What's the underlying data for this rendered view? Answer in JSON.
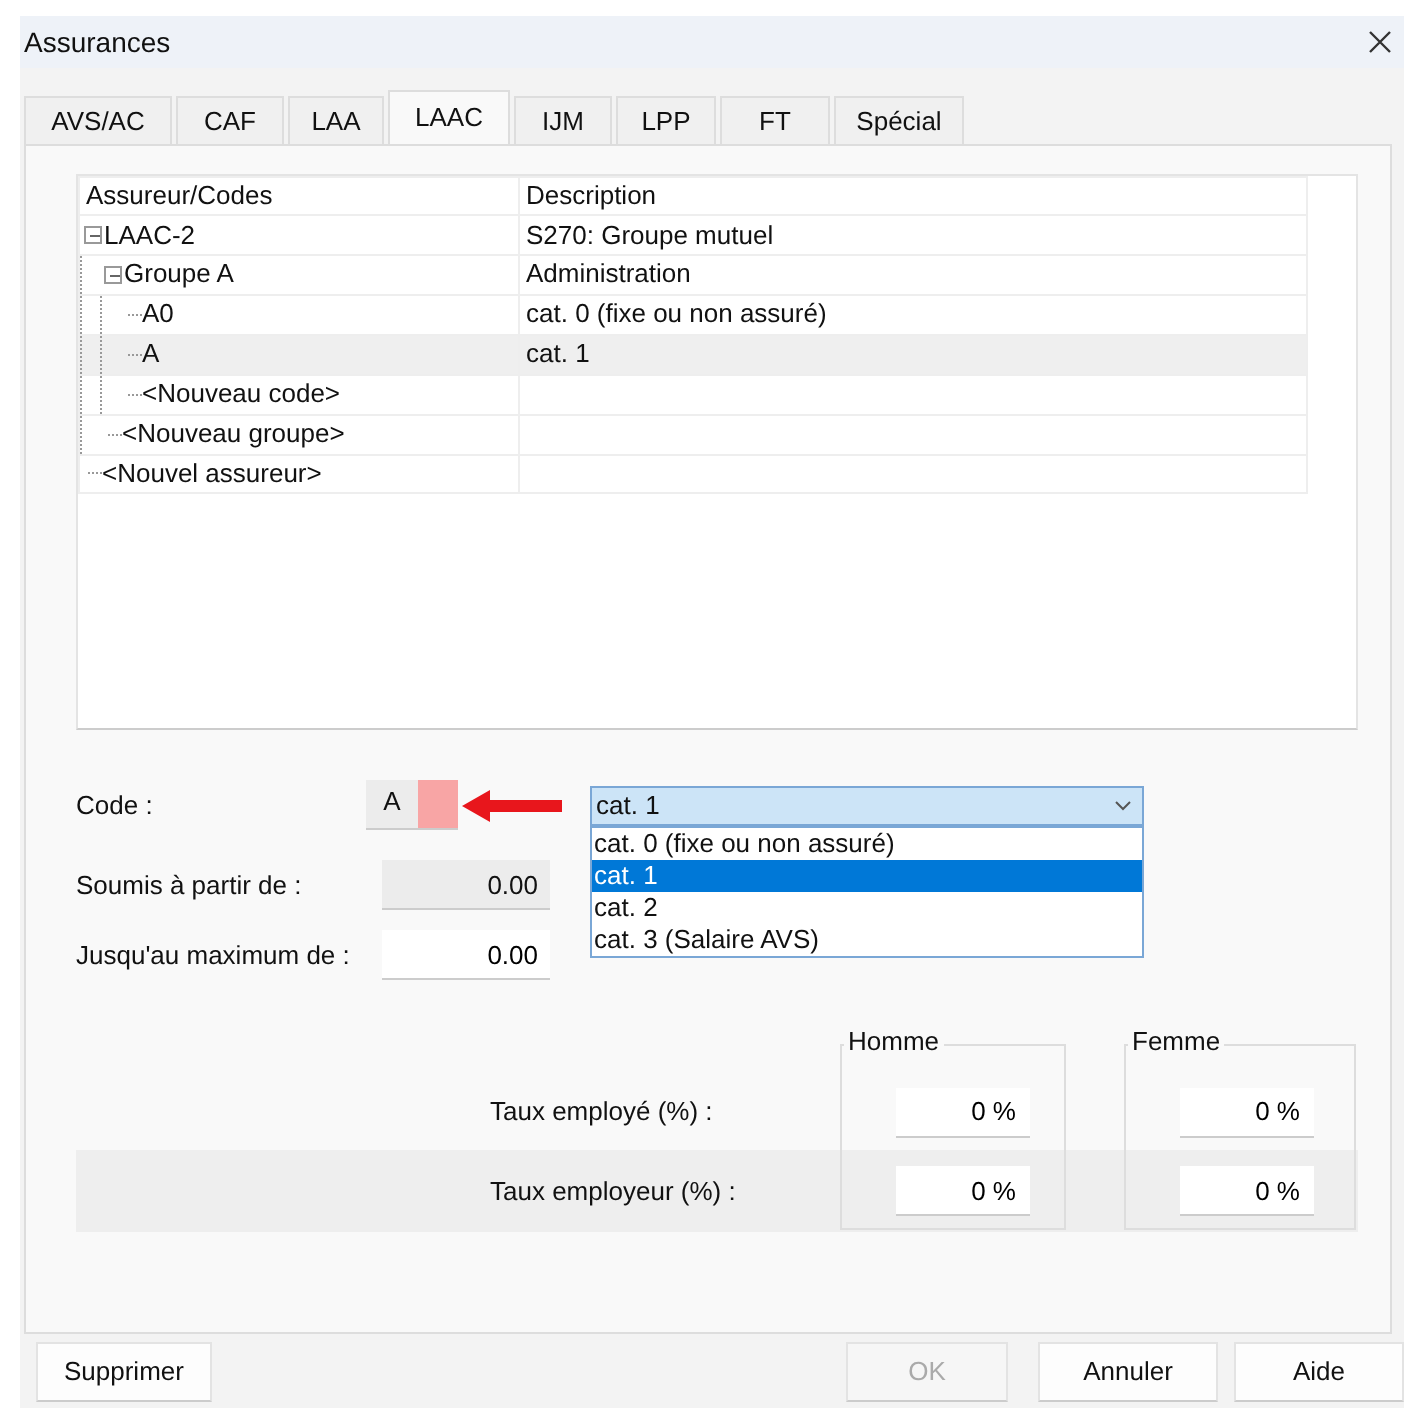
{
  "window": {
    "title": "Assurances"
  },
  "tabs": [
    {
      "label": "AVS/AC",
      "selected": false
    },
    {
      "label": "CAF",
      "selected": false
    },
    {
      "label": "LAA",
      "selected": false
    },
    {
      "label": "LAAC",
      "selected": true
    },
    {
      "label": "IJM",
      "selected": false
    },
    {
      "label": "LPP",
      "selected": false
    },
    {
      "label": "FT",
      "selected": false
    },
    {
      "label": "Spécial",
      "selected": false
    }
  ],
  "tree": {
    "columns": [
      "Assureur/Codes",
      "Description"
    ],
    "rows": [
      {
        "code": "LAAC-2",
        "description": "S270: Groupe mutuel",
        "expanded": true,
        "selected": false,
        "children": [
          {
            "code": "Groupe A",
            "description": "Administration",
            "expanded": true,
            "selected": false,
            "children": [
              {
                "code": "A0",
                "description": "cat. 0 (fixe ou non assuré)",
                "selected": false
              },
              {
                "code": "A",
                "description": "cat. 1",
                "selected": true
              },
              {
                "code": "<Nouveau code>",
                "selected": false
              }
            ]
          },
          {
            "code": "<Nouveau groupe>",
            "selected": false
          }
        ]
      },
      {
        "code": "<Nouvel assureur>",
        "selected": false
      }
    ]
  },
  "form": {
    "code": {
      "label": "Code :",
      "value": "A"
    },
    "category": {
      "value": "cat. 1",
      "options": [
        {
          "label": "cat. 0 (fixe ou non assuré)",
          "selected": false
        },
        {
          "label": "cat. 1",
          "selected": true
        },
        {
          "label": "cat. 2",
          "selected": false
        },
        {
          "label": "cat. 3 (Salaire AVS)",
          "selected": false
        }
      ]
    },
    "fields": [
      {
        "label": "Soumis à partir de :",
        "value": "0.00",
        "disabled": true
      },
      {
        "label": "Jusqu'au maximum de :",
        "value": "0.00",
        "disabled": false
      }
    ]
  },
  "rates": {
    "groups": [
      "Homme",
      "Femme"
    ],
    "rows": [
      {
        "label": "Taux employé (%) :",
        "values": [
          "0 %",
          "0 %"
        ],
        "shaded": false
      },
      {
        "label": "Taux employeur (%) :",
        "values": [
          "0 %",
          "0 %"
        ],
        "shaded": true
      }
    ]
  },
  "buttons": [
    {
      "label": "Supprimer",
      "disabled": false
    },
    {
      "label": "OK",
      "disabled": true
    },
    {
      "label": "Annuler",
      "disabled": false
    },
    {
      "label": "Aide",
      "disabled": false
    }
  ]
}
